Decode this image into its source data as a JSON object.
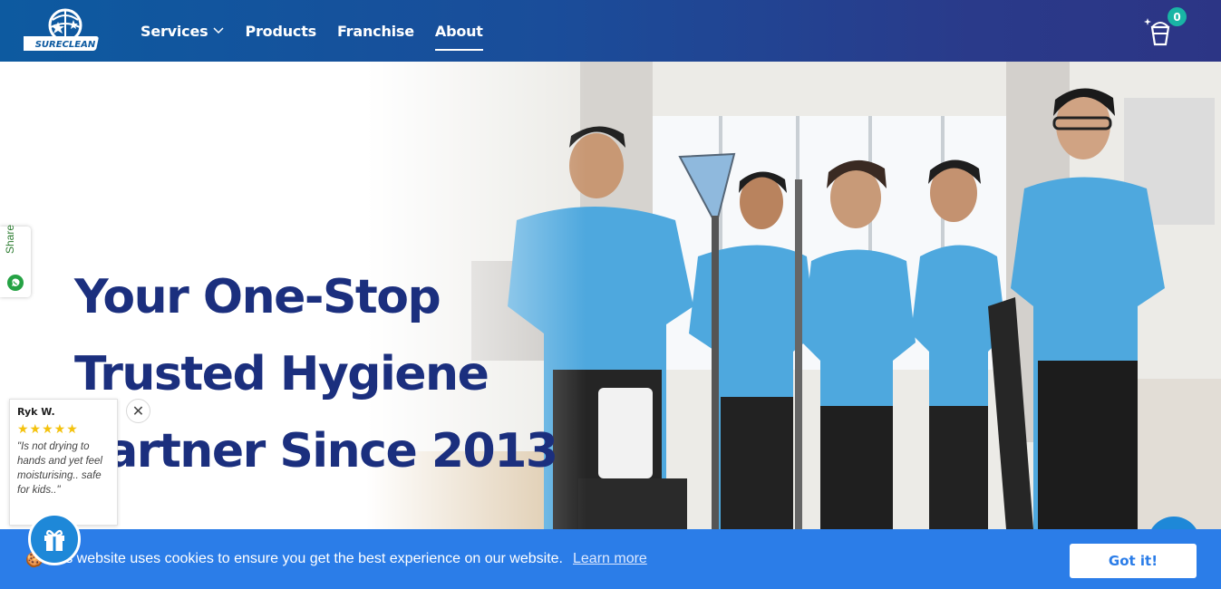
{
  "header": {
    "logo_text": "SURECLEAN",
    "nav": [
      {
        "label": "Services",
        "has_dropdown": true
      },
      {
        "label": "Products"
      },
      {
        "label": "Franchise"
      },
      {
        "label": "About",
        "active": true
      }
    ],
    "cart_count": "0"
  },
  "hero": {
    "headline": [
      "Your One-Stop",
      "Trusted Hygiene",
      "Partner Since 2013"
    ]
  },
  "share": {
    "label": "Share"
  },
  "review": {
    "name": "Ryk W.",
    "stars": "★★★★★",
    "text": "\"Is not drying to hands and yet feel moisturising.. safe for kids..\"",
    "close": "✕"
  },
  "cookie": {
    "emoji": "🍪",
    "text": "This website uses cookies to ensure you get the best experience on our website.",
    "link": "Learn more",
    "button": "Got it!"
  },
  "colors": {
    "header_start": "#0d5aa0",
    "header_end": "#2c3585",
    "headline": "#1b2f7e",
    "uniform": "#4ea8de",
    "cookie_bar": "#2b7de8",
    "badge": "#19b5a5"
  }
}
